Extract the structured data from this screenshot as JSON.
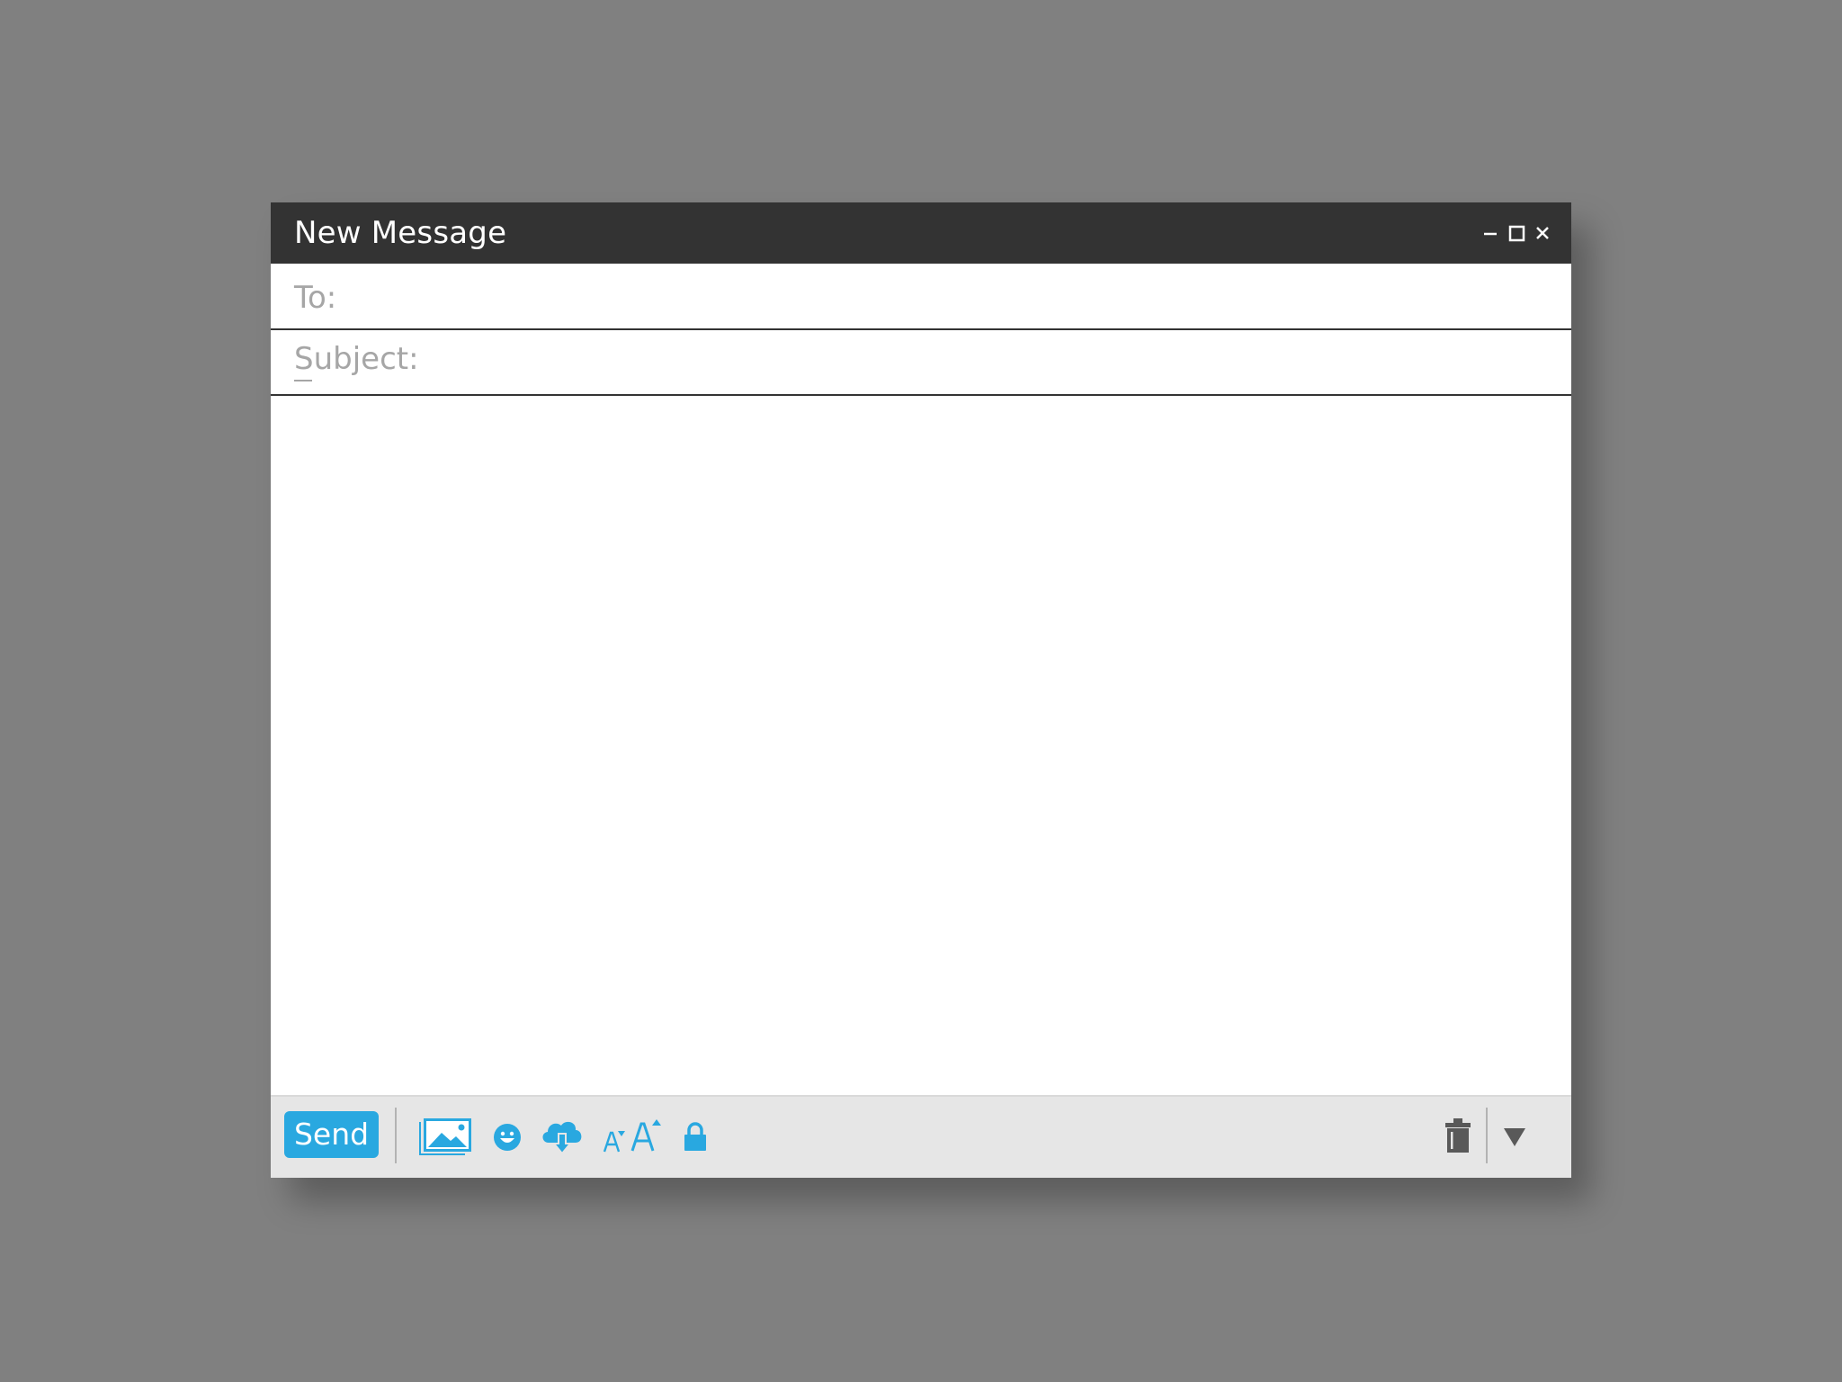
{
  "window": {
    "title": "New Message",
    "controls": {
      "minimize_icon": "minimize-icon",
      "maximize_icon": "maximize-icon",
      "close_icon": "close-icon"
    }
  },
  "fields": {
    "to_label": "To:",
    "to_value": "",
    "subject_label": "Subject:",
    "subject_value": ""
  },
  "body": {
    "value": ""
  },
  "toolbar": {
    "send_label": "Send",
    "icons": [
      "insert-image-icon",
      "emoji-icon",
      "cloud-download-icon",
      "font-size-decrease-icon",
      "font-size-increase-icon",
      "lock-icon",
      "trash-icon",
      "more-options-dropdown-icon"
    ]
  },
  "colors": {
    "background": "#808080",
    "titlebar": "#333333",
    "accent": "#29a8e0",
    "toolbar_bg": "#e6e6e6",
    "label_gray": "#a6a6a6",
    "dark_icon": "#595959"
  }
}
